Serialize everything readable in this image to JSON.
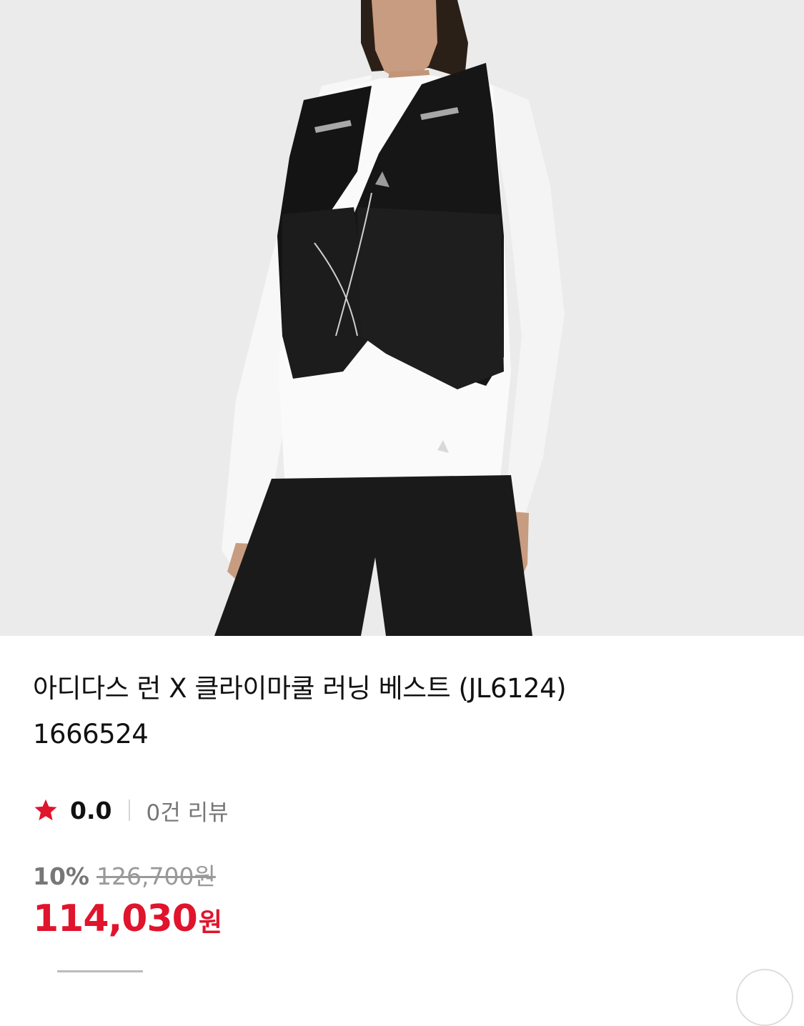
{
  "product": {
    "title_line1": "아디다스 런 X 클라이마쿨 러닝 베스트 (JL6124)",
    "title_line2": "1666524",
    "rating": "0.0",
    "review_count": "0건 리뷰",
    "discount_rate": "10%",
    "original_price": "126,700원",
    "sale_price": "114,030",
    "sale_currency": "원"
  },
  "colors": {
    "accent": "#e0142c",
    "star": "#e0142c",
    "muted_text": "#777777",
    "image_bg": "#ebebeb"
  },
  "icons": {
    "rating": "star-icon"
  }
}
